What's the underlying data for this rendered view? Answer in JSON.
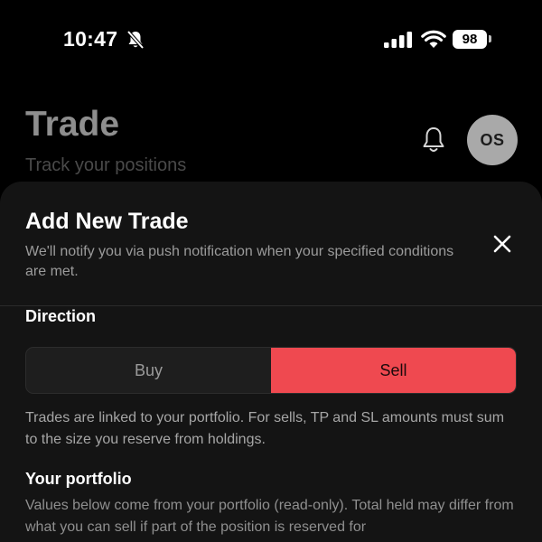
{
  "status_bar": {
    "time": "10:47",
    "battery": "98",
    "icons": [
      "bell-slash-icon",
      "cellular-signal-icon",
      "wifi-icon",
      "battery-icon"
    ]
  },
  "header": {
    "title": "Trade",
    "subtitle": "Track your positions",
    "avatar_initials": "OS",
    "icons": [
      "notification-bell-icon"
    ]
  },
  "sheet": {
    "title": "Add New Trade",
    "description": "We'll notify you via push notification when your specified conditions are met.",
    "close_icon": "close-icon",
    "direction": {
      "label": "Direction",
      "options": [
        {
          "label": "Buy",
          "selected": false
        },
        {
          "label": "Sell",
          "selected": true
        }
      ],
      "help_text": "Trades are linked to your portfolio. For sells, TP and SL amounts must sum to the size you reserve from holdings."
    },
    "portfolio": {
      "label": "Your portfolio",
      "description": "Values below come from your portfolio (read-only). Total held may differ from what you can sell if part of the position is reserved for"
    }
  },
  "colors": {
    "background": "#000000",
    "sheet": "#141414",
    "sell_accent": "#ef4950",
    "avatar": "#a9a9a9"
  }
}
